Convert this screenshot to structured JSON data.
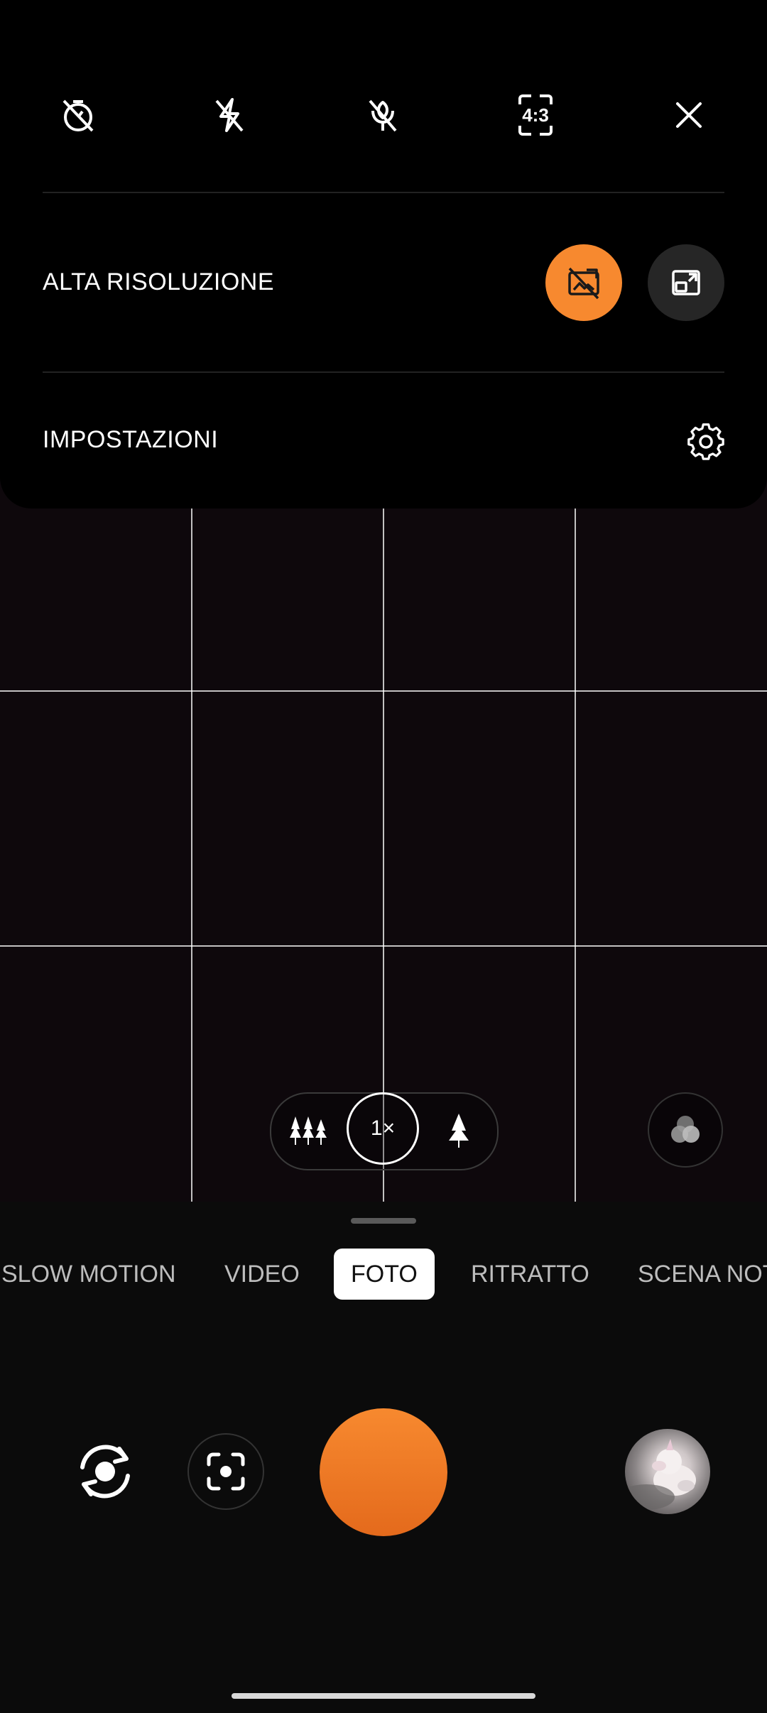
{
  "top_bar": {
    "icons": [
      "timer-off-icon",
      "flash-off-icon",
      "macro-off-icon",
      "aspect-ratio-icon",
      "close-icon"
    ],
    "aspect_ratio_label": "4:3"
  },
  "high_resolution": {
    "label": "ALTA RISOLUZIONE",
    "options": [
      "high-res-off-icon",
      "high-res-on-icon"
    ],
    "selected_index": 0
  },
  "settings": {
    "label": "IMPOSTAZIONI",
    "icon": "gear-icon"
  },
  "zoom": {
    "options": [
      "wide-angle-icon",
      "1×",
      "telephoto-icon"
    ],
    "selected": "1×"
  },
  "filter": {
    "icon": "filters-icon"
  },
  "modes": {
    "items": [
      "SLOW MOTION",
      "VIDEO",
      "FOTO",
      "RITRATTO",
      "SCENA NOT"
    ],
    "active": "FOTO"
  },
  "controls": {
    "switch_camera_icon": "camera-switch-icon",
    "lens_icon": "google-lens-icon",
    "shutter": "shutter-button",
    "gallery": "gallery-thumbnail"
  },
  "colors": {
    "accent": "#f7892f",
    "panel": "#000000",
    "background": "#0b0b0b"
  }
}
